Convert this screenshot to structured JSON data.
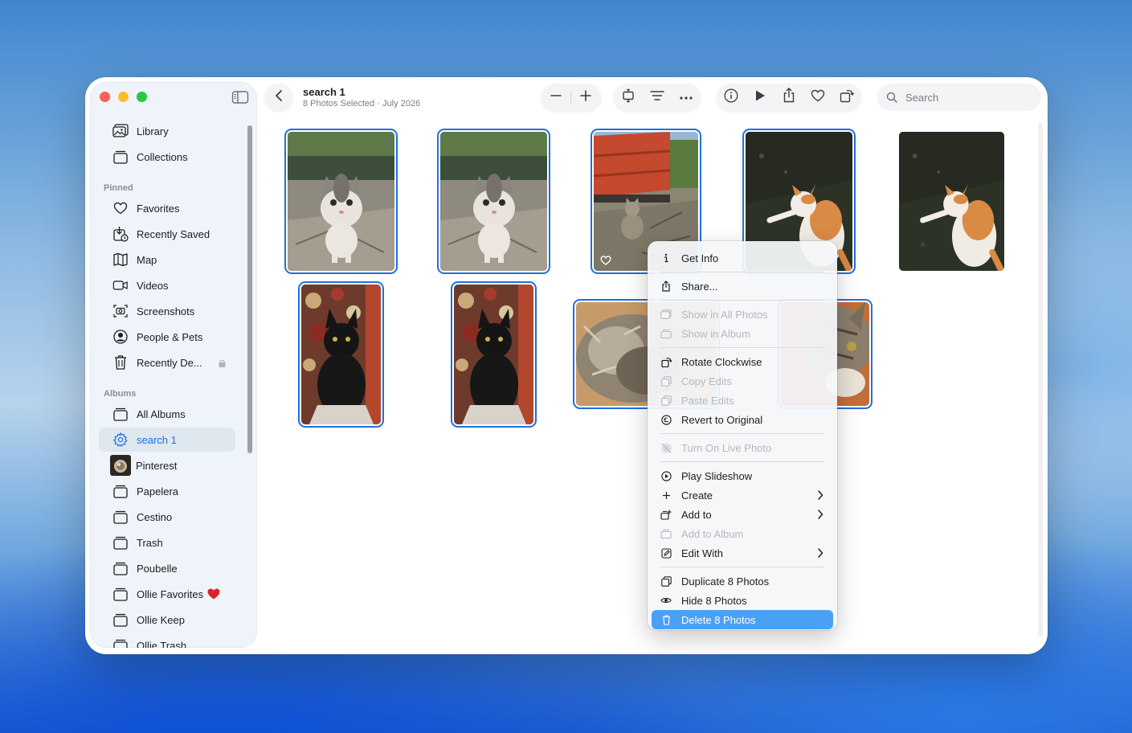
{
  "window": {
    "title": "search 1",
    "subtitle": "8 Photos Selected · July 2026"
  },
  "toolbar": {
    "search_placeholder": "Search",
    "icons": [
      "back-icon",
      "zoom-out-icon",
      "zoom-in-icon",
      "aspect-icon",
      "filter-icon",
      "more-icon",
      "info-icon",
      "play-icon",
      "share-icon",
      "heart-icon",
      "rotate-icon",
      "search-icon"
    ]
  },
  "sidebar": {
    "top_items": [
      {
        "label": "Library",
        "icon": "library-icon"
      },
      {
        "label": "Collections",
        "icon": "collections-icon"
      }
    ],
    "pinned_header": "Pinned",
    "pinned_items": [
      {
        "label": "Favorites",
        "icon": "heart-icon"
      },
      {
        "label": "Recently Saved",
        "icon": "recently-saved-icon"
      },
      {
        "label": "Map",
        "icon": "map-icon"
      },
      {
        "label": "Videos",
        "icon": "video-icon"
      },
      {
        "label": "Screenshots",
        "icon": "screenshot-icon"
      },
      {
        "label": "People & Pets",
        "icon": "person-icon"
      },
      {
        "label": "Recently De...",
        "icon": "trash-icon",
        "locked": true
      }
    ],
    "albums_header": "Albums",
    "album_items": [
      {
        "label": "All Albums",
        "icon": "album-icon"
      },
      {
        "label": "search 1",
        "icon": "smart-album-gear-icon",
        "active": true
      },
      {
        "label": "Pinterest",
        "icon": "album-thumbnail"
      },
      {
        "label": "Papelera",
        "icon": "album-icon"
      },
      {
        "label": "Cestino",
        "icon": "album-icon"
      },
      {
        "label": "Trash",
        "icon": "album-icon"
      },
      {
        "label": "Poubelle",
        "icon": "album-icon"
      },
      {
        "label": "Ollie Favorites",
        "icon": "album-icon",
        "badge": "heart-emoji"
      },
      {
        "label": "Ollie Keep",
        "icon": "album-icon"
      },
      {
        "label": "Ollie Trash",
        "icon": "album-icon"
      }
    ]
  },
  "photos": [
    {
      "subject": "kitten",
      "selected": true
    },
    {
      "subject": "kitten",
      "selected": true
    },
    {
      "subject": "tabby-by-container",
      "selected": true,
      "favorite": true
    },
    {
      "subject": "ginger-cat",
      "selected": true
    },
    {
      "subject": "ginger-cat",
      "selected": false
    },
    {
      "subject": "black-kitten",
      "selected": true
    },
    {
      "subject": "black-kitten",
      "selected": true
    },
    {
      "subject": "fluffy-cat",
      "selected": true
    },
    {
      "subject": "tabby-closeup",
      "selected": true
    }
  ],
  "context_menu": {
    "groups": [
      [
        {
          "label": "Get Info",
          "icon": "info-icon",
          "enabled": true
        }
      ],
      [
        {
          "label": "Share...",
          "icon": "share-icon",
          "enabled": true
        }
      ],
      [
        {
          "label": "Show in All Photos",
          "icon": "photos-icon",
          "enabled": false
        },
        {
          "label": "Show in Album",
          "icon": "album-icon",
          "enabled": false
        }
      ],
      [
        {
          "label": "Rotate Clockwise",
          "icon": "rotate-icon",
          "enabled": true
        },
        {
          "label": "Copy Edits",
          "icon": "copy-icon",
          "enabled": false
        },
        {
          "label": "Paste Edits",
          "icon": "paste-icon",
          "enabled": false
        },
        {
          "label": "Revert to Original",
          "icon": "revert-icon",
          "enabled": true
        }
      ],
      [
        {
          "label": "Turn On Live Photo",
          "icon": "live-photo-icon",
          "enabled": false
        }
      ],
      [
        {
          "label": "Play Slideshow",
          "icon": "play-icon",
          "enabled": true
        },
        {
          "label": "Create",
          "icon": "plus-icon",
          "enabled": true,
          "submenu": true
        },
        {
          "label": "Add to",
          "icon": "add-to-icon",
          "enabled": true,
          "submenu": true
        },
        {
          "label": "Add to Album",
          "icon": "album-icon",
          "enabled": false
        },
        {
          "label": "Edit With",
          "icon": "edit-with-icon",
          "enabled": true,
          "submenu": true
        }
      ],
      [
        {
          "label": "Duplicate 8 Photos",
          "icon": "duplicate-icon",
          "enabled": true
        },
        {
          "label": "Hide 8 Photos",
          "icon": "eye-icon",
          "enabled": true
        },
        {
          "label": "Delete 8 Photos",
          "icon": "trash-icon",
          "enabled": true,
          "highlighted": true
        }
      ]
    ]
  },
  "colors": {
    "accent": "#1f6fe0",
    "menu_highlight": "#4aa0f5",
    "traffic_red": "#fe5f57",
    "traffic_yellow": "#febc2e",
    "traffic_green": "#28c840"
  }
}
